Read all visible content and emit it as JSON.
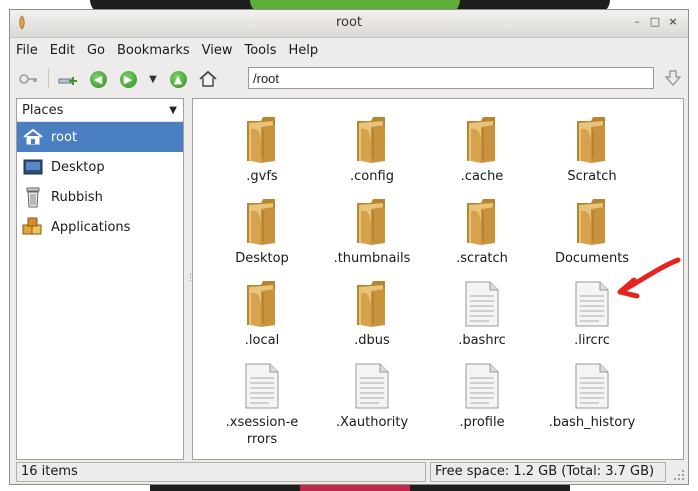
{
  "window": {
    "title": "root"
  },
  "menubar": {
    "items": [
      {
        "label": "File"
      },
      {
        "label": "Edit"
      },
      {
        "label": "Go"
      },
      {
        "label": "Bookmarks"
      },
      {
        "label": "View"
      },
      {
        "label": "Tools"
      },
      {
        "label": "Help"
      }
    ]
  },
  "toolbar": {
    "location": "/root",
    "icons": [
      "key-icon",
      "new-tab-icon",
      "back-icon",
      "forward-icon",
      "history-dropdown-icon",
      "up-icon",
      "home-icon",
      "go-icon"
    ]
  },
  "sidebar": {
    "header": "Places",
    "items": [
      {
        "label": "root",
        "icon": "home-icon",
        "selected": true
      },
      {
        "label": "Desktop",
        "icon": "desktop-icon",
        "selected": false
      },
      {
        "label": "Rubbish",
        "icon": "trash-icon",
        "selected": false
      },
      {
        "label": "Applications",
        "icon": "applications-icon",
        "selected": false
      }
    ]
  },
  "files": [
    {
      "name": ".gvfs",
      "type": "folder"
    },
    {
      "name": ".config",
      "type": "folder"
    },
    {
      "name": ".cache",
      "type": "folder"
    },
    {
      "name": "Scratch",
      "type": "folder"
    },
    {
      "name": "Desktop",
      "type": "folder"
    },
    {
      "name": ".thumbnails",
      "type": "folder"
    },
    {
      "name": ".scratch",
      "type": "folder"
    },
    {
      "name": "Documents",
      "type": "folder"
    },
    {
      "name": ".local",
      "type": "folder"
    },
    {
      "name": ".dbus",
      "type": "folder"
    },
    {
      "name": ".bashrc",
      "type": "file"
    },
    {
      "name": ".lircrc",
      "type": "file"
    },
    {
      "name": ".xsession-errors",
      "type": "file"
    },
    {
      "name": ".Xauthority",
      "type": "file"
    },
    {
      "name": ".profile",
      "type": "file"
    },
    {
      "name": ".bash_history",
      "type": "file"
    }
  ],
  "status": {
    "items_count": "16 items",
    "free_space": "Free space: 1.2 GB (Total: 3.7 GB)"
  },
  "colors": {
    "selection": "#4a7fc1",
    "folder": "#d9a84a",
    "annotation_arrow": "#e8221e"
  }
}
